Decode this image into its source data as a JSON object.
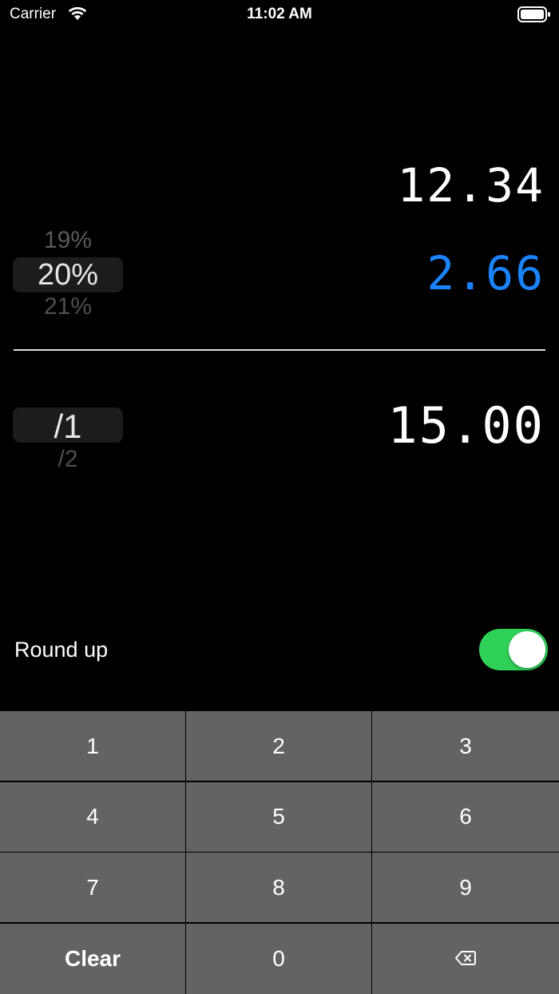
{
  "status_bar": {
    "carrier": "Carrier",
    "time": "11:02 AM"
  },
  "bill": {
    "amount": "12.34"
  },
  "tip": {
    "amount": "2.66",
    "amount_color": "#1a84ff",
    "picker": {
      "previous": "19%",
      "selected": "20%",
      "next": "21%"
    }
  },
  "split": {
    "picker": {
      "selected": "/1",
      "next": "/2"
    }
  },
  "total": {
    "amount": "15.00"
  },
  "round_up": {
    "label": "Round up",
    "enabled": true,
    "toggle_color": "#30d158"
  },
  "keypad": {
    "keys": [
      "1",
      "2",
      "3",
      "4",
      "5",
      "6",
      "7",
      "8",
      "9",
      "Clear",
      "0"
    ],
    "backspace_icon": "delete-backward-icon",
    "key_color": "#636366"
  }
}
